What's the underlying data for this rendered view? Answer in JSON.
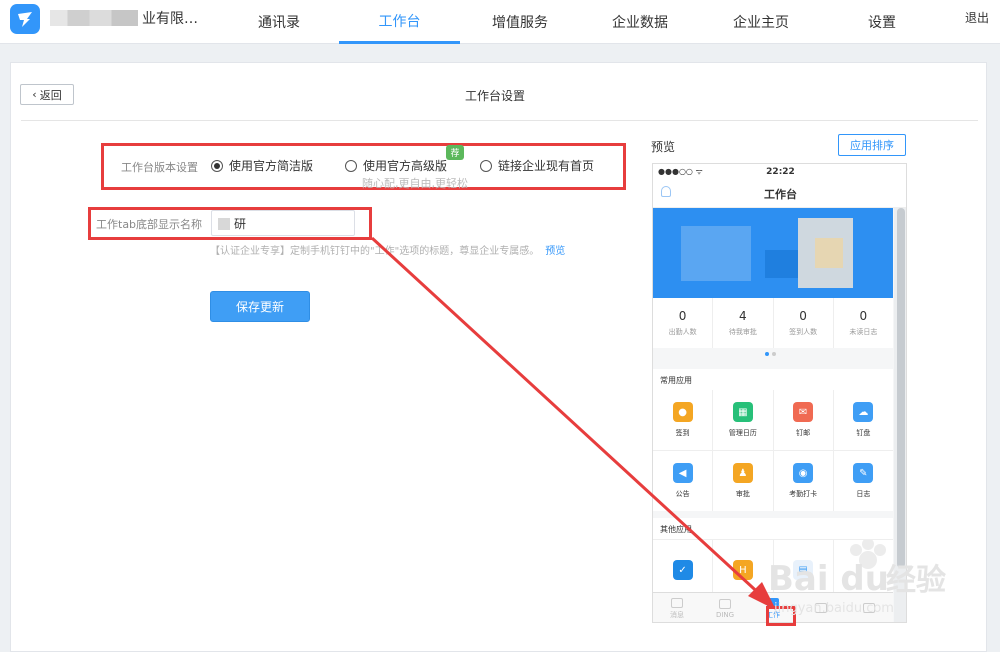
{
  "header": {
    "corp_name": "业有限…",
    "nav": [
      "通讯录",
      "工作台",
      "增值服务",
      "企业数据",
      "企业主页",
      "设置"
    ],
    "active_nav": 1,
    "logout": "退出"
  },
  "page": {
    "back_label": "返回",
    "title": "工作台设置"
  },
  "form": {
    "version_label": "工作台版本设置",
    "options": [
      "使用官方简洁版",
      "使用官方高级版",
      "链接企业现有首页"
    ],
    "selected_option": 0,
    "recommend_badge": "荐",
    "option_subtitle": "随心配,更自由,更轻松",
    "tab_name_label": "工作tab底部显示名称",
    "tab_name_value": "研",
    "hint_text": "【认证企业专享】定制手机钉钉中的\"工作\"选项的标题，尊显企业专属感。",
    "hint_link": "预览",
    "save_label": "保存更新"
  },
  "preview": {
    "label": "预览",
    "sort_button": "应用排序",
    "phone": {
      "signal": "●●●○○ ᯤ",
      "time": "22:22",
      "title": "工作台",
      "stats": [
        {
          "value": "0",
          "label": "出勤人数"
        },
        {
          "value": "4",
          "label": "待我审批"
        },
        {
          "value": "0",
          "label": "签到人数"
        },
        {
          "value": "0",
          "label": "未读日志"
        }
      ],
      "section_common": "常用应用",
      "apps": [
        {
          "name": "签到",
          "color": "#f4a623",
          "icon": "pin-icon"
        },
        {
          "name": "管理日历",
          "color": "#27c079",
          "icon": "calendar-icon"
        },
        {
          "name": "钉邮",
          "color": "#f06a52",
          "icon": "mail-icon"
        },
        {
          "name": "钉盘",
          "color": "#3f9ef5",
          "icon": "cloud-icon"
        },
        {
          "name": "公告",
          "color": "#3f9ef5",
          "icon": "speaker-icon"
        },
        {
          "name": "审批",
          "color": "#f4a623",
          "icon": "person-icon"
        },
        {
          "name": "考勤打卡",
          "color": "#3f9ef5",
          "icon": "location-icon"
        },
        {
          "name": "日志",
          "color": "#3f9ef5",
          "icon": "note-icon"
        }
      ],
      "section_other": "其他应用",
      "tabs": [
        "消息",
        "DING",
        "工作",
        "",
        ""
      ]
    }
  }
}
